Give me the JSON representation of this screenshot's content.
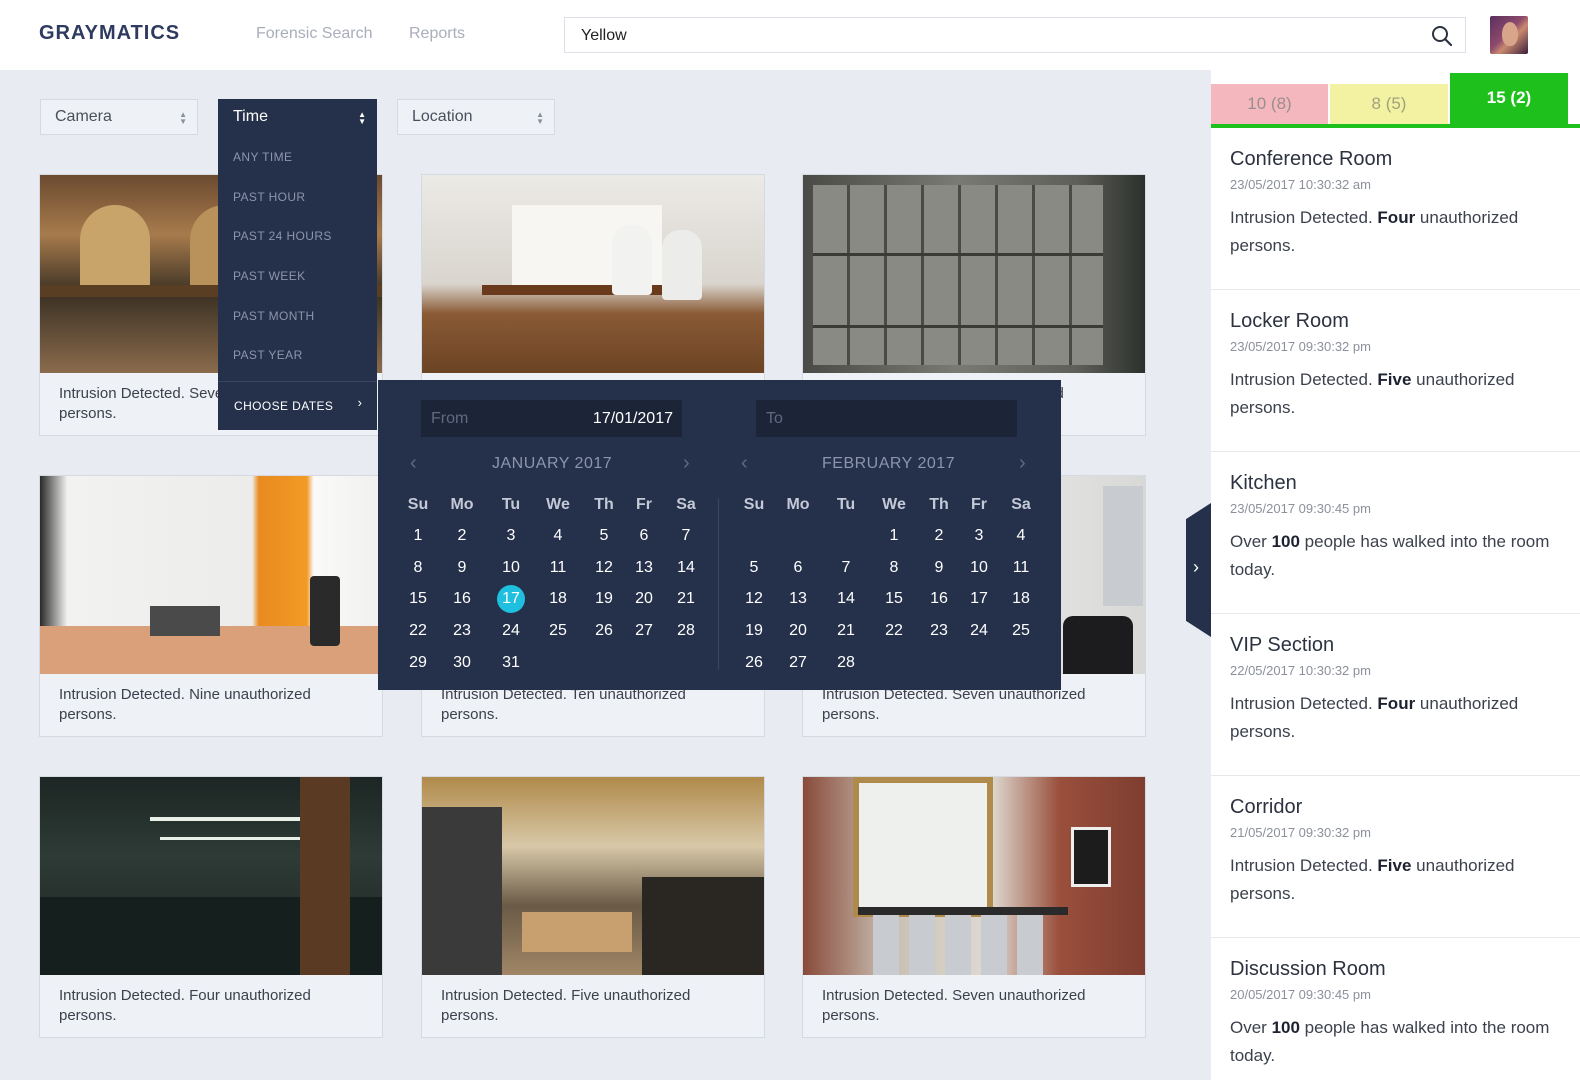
{
  "app": {
    "logo": "GRAYMATICS"
  },
  "nav": {
    "forensic_search": "Forensic Search",
    "reports": "Reports"
  },
  "search": {
    "value": "Yellow"
  },
  "filters": {
    "camera": "Camera",
    "time": "Time",
    "location": "Location"
  },
  "time_menu": {
    "items": [
      "ANY TIME",
      "PAST HOUR",
      "PAST 24 HOURS",
      "PAST WEEK",
      "PAST MONTH",
      "PAST YEAR"
    ],
    "choose_dates": "CHOOSE DATES"
  },
  "datepicker": {
    "from_label": "From",
    "from_value": "17/01/2017",
    "to_label": "To",
    "left_month": "JANUARY 2017",
    "right_month": "FEBRUARY 2017",
    "weekdays": [
      "Su",
      "Mo",
      "Tu",
      "We",
      "Th",
      "Fr",
      "Sa"
    ],
    "selected_day": "17"
  },
  "cards": [
    {
      "caption": "Intrusion Detected. Seven unauthorized persons."
    },
    {
      "caption": ""
    },
    {
      "caption": "Intrusion Detected. Six unauthorized persons."
    },
    {
      "caption": "Intrusion Detected. Nine unauthorized persons."
    },
    {
      "caption": "Intrusion Detected. Ten unauthorized persons."
    },
    {
      "caption": "Intrusion Detected. Seven unauthorized persons."
    },
    {
      "caption": "Intrusion Detected. Four unauthorized persons."
    },
    {
      "caption": "Intrusion Detected. Five unauthorized persons."
    },
    {
      "caption": "Intrusion Detected. Seven unauthorized persons."
    }
  ],
  "stats": {
    "red": "10 (8)",
    "yellow": "8 (5)",
    "green": "15 (2)"
  },
  "alerts": [
    {
      "title": "Conference Room",
      "time": "23/05/2017  10:30:32 am",
      "pre": "Intrusion Detected. ",
      "bold": "Four",
      "post": " unauthorized persons."
    },
    {
      "title": "Locker Room",
      "time": "23/05/2017  09:30:32 pm",
      "pre": "Intrusion Detected. ",
      "bold": "Five",
      "post": " unauthorized persons."
    },
    {
      "title": "Kitchen",
      "time": "23/05/2017  09:30:45 pm",
      "pre": "Over ",
      "bold": "100",
      "post": " people has walked into the room today."
    },
    {
      "title": "VIP Section",
      "time": "22/05/2017  10:30:32 pm",
      "pre": "Intrusion Detected. ",
      "bold": "Four",
      "post": " unauthorized persons."
    },
    {
      "title": "Corridor",
      "time": "21/05/2017  09:30:32 pm",
      "pre": "Intrusion Detected. ",
      "bold": "Five",
      "post": " unauthorized persons."
    },
    {
      "title": "Discussion Room",
      "time": "20/05/2017  09:30:45 pm",
      "pre": "Over ",
      "bold": "100",
      "post": " people has walked into the room today."
    }
  ],
  "colors": {
    "accent": "#1fbfe0",
    "dark_panel": "#25304a",
    "green": "#1ec11b",
    "red_tab": "#f4b7bd",
    "yellow_tab": "#f3f2a2"
  }
}
